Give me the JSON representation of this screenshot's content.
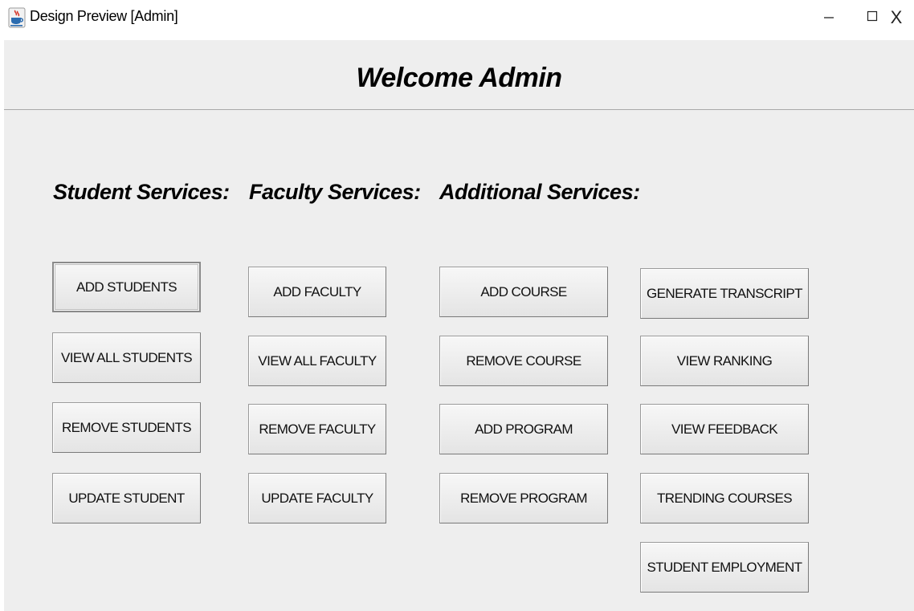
{
  "window": {
    "title": "Design Preview [Admin]",
    "minimize_glyph": "–",
    "close_glyph": "X"
  },
  "header": {
    "welcome": "Welcome Admin"
  },
  "sections": {
    "student": "Student Services:",
    "faculty": "Faculty Services:",
    "additional": "Additional Services:"
  },
  "buttons": {
    "student": [
      "ADD STUDENTS",
      "VIEW ALL STUDENTS",
      "REMOVE STUDENTS",
      "UPDATE STUDENT"
    ],
    "faculty": [
      "ADD FACULTY",
      "VIEW ALL FACULTY",
      "REMOVE FACULTY",
      "UPDATE FACULTY"
    ],
    "additional": [
      "ADD COURSE",
      "REMOVE COURSE",
      "ADD PROGRAM",
      "REMOVE PROGRAM"
    ],
    "reports": [
      "GENERATE TRANSCRIPT",
      "VIEW RANKING",
      "VIEW FEEDBACK",
      "TRENDING COURSES",
      "STUDENT EMPLOYMENT"
    ]
  },
  "icons": {
    "app": "java-coffee-cup-icon",
    "minimize": "minimize-icon",
    "maximize": "maximize-icon",
    "close": "close-icon"
  },
  "colors": {
    "background": "#eeeeee",
    "button_face": "#eaeaea",
    "button_border": "#9a9a9a"
  }
}
